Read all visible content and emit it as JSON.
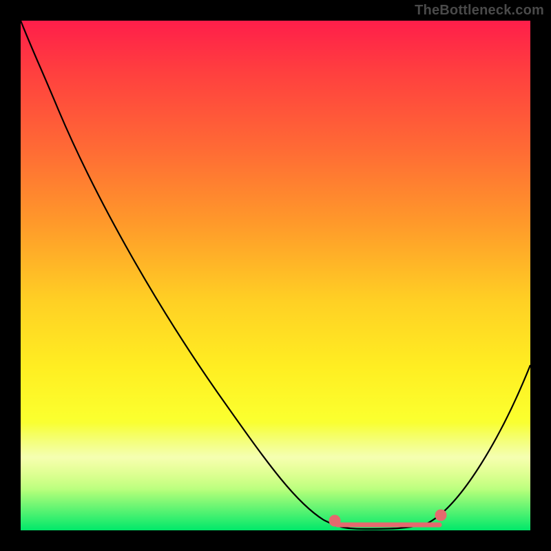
{
  "watermark": "TheBottleneck.com",
  "colors": {
    "background": "#000000",
    "gradient_top": "#ff1e4a",
    "gradient_mid": "#ffee22",
    "gradient_bottom": "#00e86a",
    "curve": "#000000",
    "tolerance_marker": "#e46a6e",
    "watermark_text": "#4a4a4a"
  },
  "chart_data": {
    "type": "line",
    "title": "",
    "xlabel": "",
    "ylabel": "",
    "xlim": [
      0,
      100
    ],
    "ylim": [
      0,
      100
    ],
    "series": [
      {
        "name": "bottleneck-curve",
        "x": [
          0,
          4,
          12,
          22,
          32,
          42,
          50,
          56,
          60,
          64,
          70,
          76,
          80,
          84,
          90,
          96,
          100
        ],
        "y": [
          100,
          94,
          80,
          64,
          48,
          32,
          19,
          9,
          4,
          1,
          0,
          0,
          1,
          4,
          12,
          24,
          35
        ]
      },
      {
        "name": "tolerance-band",
        "x": [
          62,
          84
        ],
        "y": [
          1,
          1
        ]
      }
    ],
    "annotations": [
      {
        "text": "TheBottleneck.com",
        "role": "watermark"
      }
    ]
  }
}
